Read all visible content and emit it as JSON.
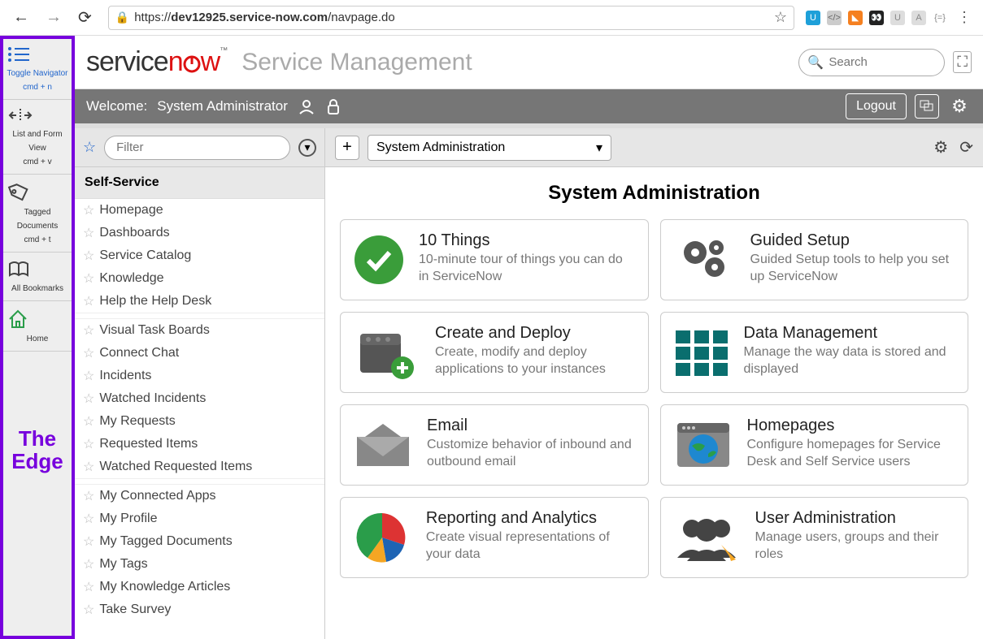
{
  "browser": {
    "url_prefix": "https://",
    "url_host": "dev12925.service-now.com",
    "url_path": "/navpage.do"
  },
  "header": {
    "logo_a": "service",
    "logo_b": "now",
    "tm": "™",
    "title": "Service Management",
    "search_placeholder": "Search"
  },
  "welcome": {
    "label": "Welcome:",
    "user": "System Administrator",
    "logout": "Logout"
  },
  "edge": {
    "overlay": "The Edge",
    "items": [
      {
        "label": "Toggle Navigator",
        "shortcut": "cmd + n",
        "icon": "list"
      },
      {
        "label": "List and Form View",
        "shortcut": "cmd + v",
        "icon": "split"
      },
      {
        "label": "Tagged Documents",
        "shortcut": "cmd + t",
        "icon": "tag"
      },
      {
        "label": "All Bookmarks",
        "shortcut": "",
        "icon": "book"
      },
      {
        "label": "Home",
        "shortcut": "",
        "icon": "home"
      }
    ]
  },
  "nav": {
    "filter_placeholder": "Filter",
    "section": "Self-Service",
    "group1": [
      "Homepage",
      "Dashboards",
      "Service Catalog",
      "Knowledge",
      "Help the Help Desk"
    ],
    "group2": [
      "Visual Task Boards",
      "Connect Chat",
      "Incidents",
      "Watched Incidents",
      "My Requests",
      "Requested Items",
      "Watched Requested Items"
    ],
    "group3": [
      "My Connected Apps",
      "My Profile",
      "My Tagged Documents",
      "My Tags",
      "My Knowledge Articles",
      "Take Survey"
    ]
  },
  "content": {
    "dropdown": "System Administration",
    "title": "System Administration",
    "cards": [
      {
        "title": "10 Things",
        "desc": "10-minute tour of things you can do in ServiceNow",
        "icon": "check"
      },
      {
        "title": "Guided Setup",
        "desc": "Guided Setup tools to help you set up ServiceNow",
        "icon": "gears"
      },
      {
        "title": "Create and Deploy",
        "desc": "Create, modify and deploy applications to your instances",
        "icon": "deploy"
      },
      {
        "title": "Data Management",
        "desc": "Manage the way data is stored and displayed",
        "icon": "grid"
      },
      {
        "title": "Email",
        "desc": "Customize behavior of inbound and outbound email",
        "icon": "mail"
      },
      {
        "title": "Homepages",
        "desc": "Configure homepages for Service Desk and Self Service users",
        "icon": "globe"
      },
      {
        "title": "Reporting and Analytics",
        "desc": "Create visual representations of your data",
        "icon": "pie"
      },
      {
        "title": "User Administration",
        "desc": "Manage users, groups and their roles",
        "icon": "users"
      }
    ]
  }
}
